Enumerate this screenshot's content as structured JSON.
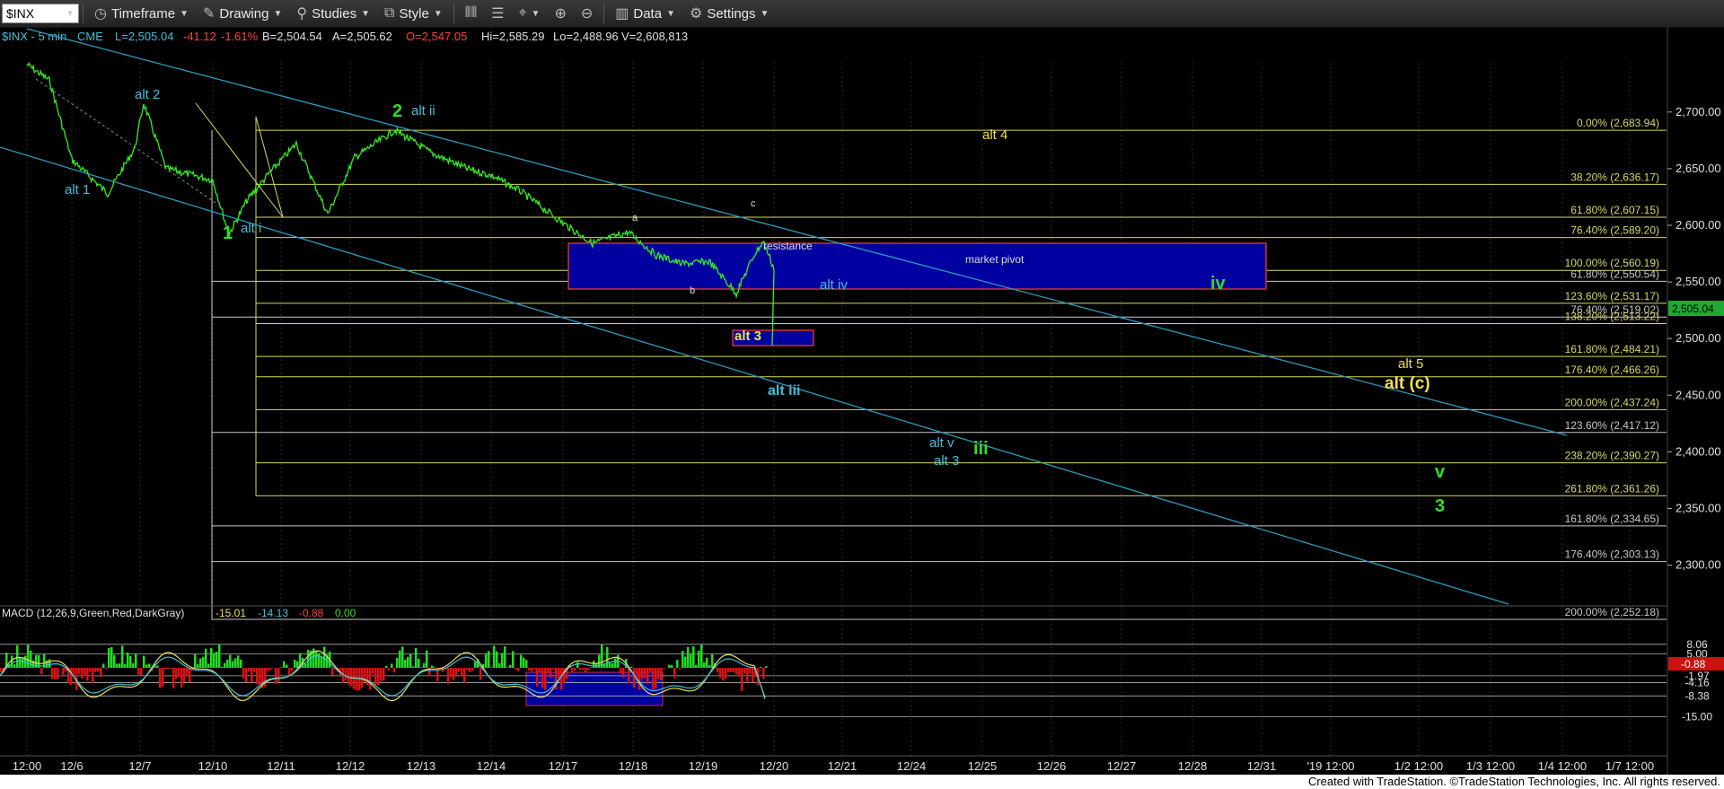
{
  "toolbar": {
    "symbol": "$INX",
    "timeframe": "Timeframe",
    "drawing": "Drawing",
    "studies": "Studies",
    "style": "Style",
    "data": "Data",
    "settings": "Settings"
  },
  "header": {
    "title": "$INX - 5 min",
    "exchange": "CME",
    "last": "L=2,505.04",
    "change": "-41.12",
    "pct": "-1.61%",
    "bid": "B=2,504.54",
    "ask": "A=2,505.62",
    "open": "O=2,547.05",
    "high": "Hi=2,585.29",
    "low": "Lo=2,488.96",
    "volume": "V=2,608,813"
  },
  "colors": {
    "price": "#33ee22",
    "fib_yellow": "#d8d860",
    "fib_gray": "#c8c8c8",
    "label_cyan": "#40c0d8",
    "label_green": "#33dd22",
    "label_yellow": "#f0e050",
    "zone_fill": "#0000a0",
    "zone_border": "#d03030",
    "trend_line": "#2a9cc0"
  },
  "chart_data": {
    "type": "line",
    "series": [
      {
        "x": [
          "12/5",
          "12/6",
          "12/6",
          "12/6",
          "12/7",
          "12/7",
          "12/7",
          "12/10",
          "12/10",
          "12/10",
          "12/11",
          "12/11",
          "12/11",
          "12/12",
          "12/12",
          "12/13",
          "12/13",
          "12/14",
          "12/14",
          "12/17",
          "12/17",
          "12/17",
          "12/18",
          "12/18",
          "12/18",
          "12/19",
          "12/19",
          "12/19",
          "12/19",
          "12/19"
        ],
        "y": [
          2742,
          2728,
          2658,
          2628,
          2668,
          2708,
          2650,
          2640,
          2592,
          2622,
          2646,
          2672,
          2610,
          2660,
          2684,
          2664,
          2650,
          2644,
          2630,
          2602,
          2584,
          2594,
          2574,
          2566,
          2568,
          2540,
          2574,
          2586,
          2562,
          2494
        ]
      }
    ],
    "y_axis": {
      "range": [
        2210,
        2760
      ],
      "ticks": [
        "2,700.00",
        "2,650.00",
        "2,600.00",
        "2,550.00",
        "2,500.00",
        "2,450.00",
        "2,400.00",
        "2,350.00",
        "2,300.00"
      ],
      "last_price": "2,505.04"
    },
    "x_axis": {
      "ticks": [
        "12:00",
        "12/6",
        "12/7",
        "12/10",
        "12/11",
        "12/12",
        "12/13",
        "12/14",
        "12/17",
        "12/18",
        "12/19",
        "12/20",
        "12/21",
        "12/24",
        "12/25",
        "12/26",
        "12/27",
        "12/28",
        "12/31",
        "'19 12:00",
        "1/2 12:00",
        "1/3 12:00",
        "1/4 12:00",
        "1/7 12:00"
      ]
    },
    "fib_levels": [
      {
        "label": "0.00% (2,683.94)",
        "value": 2683.94,
        "color": "yellow"
      },
      {
        "label": "38.20% (2,636.17)",
        "value": 2636.17,
        "color": "yellow"
      },
      {
        "label": "61.80% (2,607.15)",
        "value": 2607.15,
        "color": "yellow"
      },
      {
        "label": "76.40% (2,589.20)",
        "value": 2589.2,
        "color": "yellow"
      },
      {
        "label": "100.00% (2,560.19)",
        "value": 2560.19,
        "color": "yellow"
      },
      {
        "label": "61.80% (2,550.54)",
        "value": 2550.54,
        "color": "gray"
      },
      {
        "label": "123.60% (2,531.17)",
        "value": 2531.17,
        "color": "yellow"
      },
      {
        "label": "76.40% (2,519.02)",
        "value": 2519.02,
        "color": "gray"
      },
      {
        "label": "138.20% (2,513.22)",
        "value": 2513.22,
        "color": "yellow"
      },
      {
        "label": "161.80% (2,484.21)",
        "value": 2484.21,
        "color": "yellow"
      },
      {
        "label": "176.40% (2,466.26)",
        "value": 2466.26,
        "color": "yellow"
      },
      {
        "label": "200.00% (2,437.24)",
        "value": 2437.24,
        "color": "yellow"
      },
      {
        "label": "123.60% (2,417.12)",
        "value": 2417.12,
        "color": "gray"
      },
      {
        "label": "238.20% (2,390.27)",
        "value": 2390.27,
        "color": "yellow"
      },
      {
        "label": "261.80% (2,361.26)",
        "value": 2361.26,
        "color": "yellow"
      },
      {
        "label": "161.80% (2,334.65)",
        "value": 2334.65,
        "color": "gray"
      },
      {
        "label": "176.40% (2,303.13)",
        "value": 2303.13,
        "color": "gray"
      },
      {
        "label": "200.00% (2,252.18)",
        "value": 2252.18,
        "color": "gray"
      }
    ],
    "annotations": [
      {
        "text": "alt 1",
        "color": "cyan"
      },
      {
        "text": "alt 2",
        "color": "cyan"
      },
      {
        "text": "1",
        "color": "green"
      },
      {
        "text": "alt i",
        "color": "cyan"
      },
      {
        "text": "2",
        "color": "green"
      },
      {
        "text": "alt ii",
        "color": "cyan"
      },
      {
        "text": "a",
        "color": "gray"
      },
      {
        "text": "b",
        "color": "gray"
      },
      {
        "text": "c",
        "color": "gray"
      },
      {
        "text": "resistance",
        "color": "gray"
      },
      {
        "text": "market pivot",
        "color": "gray"
      },
      {
        "text": "alt iv",
        "color": "cyan"
      },
      {
        "text": "iv",
        "color": "green"
      },
      {
        "text": "alt 3",
        "color": "yellow"
      },
      {
        "text": "alt iii",
        "color": "cyan"
      },
      {
        "text": "alt 4",
        "color": "yellow"
      },
      {
        "text": "alt v",
        "color": "cyan"
      },
      {
        "text": "alt 3",
        "color": "cyan"
      },
      {
        "text": "iii",
        "color": "green"
      },
      {
        "text": "alt 5",
        "color": "yellow"
      },
      {
        "text": "alt (c)",
        "color": "yellow"
      },
      {
        "text": "v",
        "color": "green"
      },
      {
        "text": "3",
        "color": "green"
      }
    ],
    "macd": {
      "title": "MACD (12,26,9,Green,Red,DarkGray)",
      "values": [
        "-15.01",
        "-14.13",
        "-0.88",
        "0.00"
      ],
      "ticks": [
        "8.06",
        "5.00",
        "-1.97",
        "-4.16",
        "-8.38",
        "-15.00"
      ],
      "last": "-0.88"
    }
  },
  "status": "Created with TradeStation. ©TradeStation Technologies, Inc. All rights reserved."
}
